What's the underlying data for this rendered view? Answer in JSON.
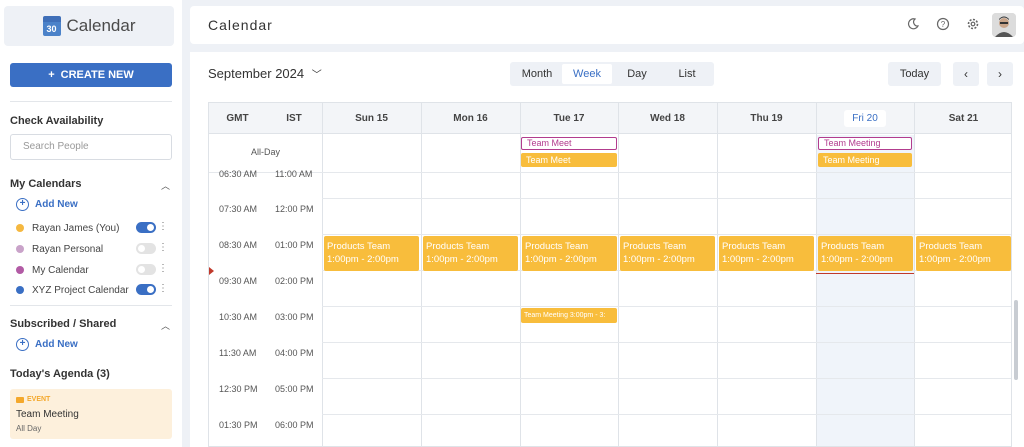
{
  "sidebar": {
    "logo_text": "Calendar",
    "logo_day": "30",
    "create_label": "CREATE NEW",
    "check_availability": "Check Availability",
    "search_placeholder": "Search People",
    "my_calendars_title": "My Calendars",
    "add_new": "Add New",
    "calendars": [
      {
        "name": "Rayan James (You)",
        "color": "#f5b840",
        "enabled": true
      },
      {
        "name": "Rayan Personal",
        "color": "#c9a3c9",
        "enabled": false
      },
      {
        "name": "My Calendar",
        "color": "#b25ba5",
        "enabled": false
      },
      {
        "name": "XYZ Project Calendar",
        "color": "#3a6fc4",
        "enabled": true
      }
    ],
    "subscribed_title": "Subscribed / Shared",
    "agenda_title": "Today's Agenda (3)",
    "agenda": {
      "type": "EVENT",
      "title": "Team Meeting",
      "sub": "All Day"
    }
  },
  "header": {
    "title": "Calendar",
    "icons": [
      "moon-icon",
      "help-icon",
      "gear-icon"
    ]
  },
  "toolbar": {
    "month": "September 2024",
    "views": [
      "Month",
      "Week",
      "Day",
      "List"
    ],
    "active_view": "Week",
    "today": "Today"
  },
  "grid": {
    "tz1": "GMT",
    "tz2": "IST",
    "days": [
      "Sun 15",
      "Mon 16",
      "Tue 17",
      "Wed 18",
      "Thu 19",
      "Fri 20",
      "Sat 21"
    ],
    "today_index": 5,
    "all_day_label": "All-Day",
    "times": [
      {
        "gmt": "06:30 AM",
        "ist": "11:00 AM"
      },
      {
        "gmt": "07:30 AM",
        "ist": "12:00 PM"
      },
      {
        "gmt": "08:30 AM",
        "ist": "01:00 PM"
      },
      {
        "gmt": "09:30 AM",
        "ist": "02:00 PM"
      },
      {
        "gmt": "10:30 AM",
        "ist": "03:00 PM"
      },
      {
        "gmt": "11:30 AM",
        "ist": "04:00 PM"
      },
      {
        "gmt": "12:30 PM",
        "ist": "05:00 PM"
      },
      {
        "gmt": "01:30 PM",
        "ist": "06:00 PM"
      }
    ],
    "allday_events": {
      "tue_outline": "Team Meet",
      "tue_fill": "Team Meet",
      "fri_outline": "Team Meeting",
      "fri_fill": "Team Meeting"
    },
    "block_event": {
      "title": "Products Team",
      "time": "1:00pm - 2:00pm"
    },
    "small_event": "Team Meeting 3:00pm - 3:"
  }
}
